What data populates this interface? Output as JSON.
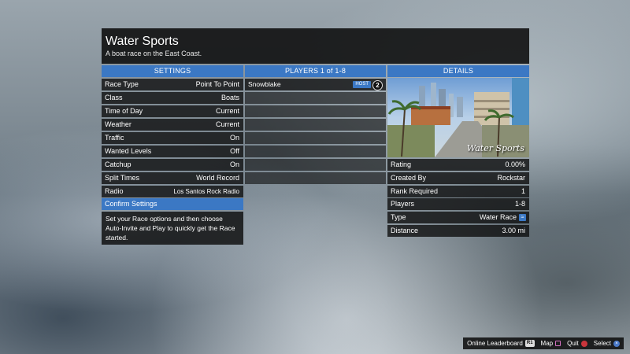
{
  "title": "Water Sports",
  "subtitle": "A boat race on the East Coast.",
  "columns": {
    "settings": "SETTINGS",
    "players": "PLAYERS 1 of 1-8",
    "details": "DETAILS"
  },
  "settings": [
    {
      "label": "Race Type",
      "value": "Point To Point"
    },
    {
      "label": "Class",
      "value": "Boats"
    },
    {
      "label": "Time of Day",
      "value": "Current"
    },
    {
      "label": "Weather",
      "value": "Current"
    },
    {
      "label": "Traffic",
      "value": "On"
    },
    {
      "label": "Wanted Levels",
      "value": "Off"
    },
    {
      "label": "Catchup",
      "value": "On"
    },
    {
      "label": "Split Times",
      "value": "World Record"
    },
    {
      "label": "Radio",
      "value": "Los Santos Rock Radio"
    }
  ],
  "confirm_label": "Confirm Settings",
  "info_text": "Set your Race options and then choose Auto-Invite and Play to quickly get the Race started.",
  "players": [
    {
      "name": "Snowblake",
      "badge": "HOST",
      "rank": "2"
    }
  ],
  "preview_caption": "Water Sports",
  "details": [
    {
      "label": "Rating",
      "value": "0.00%"
    },
    {
      "label": "Created By",
      "value": "Rockstar"
    },
    {
      "label": "Rank Required",
      "value": "1"
    },
    {
      "label": "Players",
      "value": "1-8"
    },
    {
      "label": "Type",
      "value": "Water Race"
    },
    {
      "label": "Distance",
      "value": "3.00 mi"
    }
  ],
  "bottom_bar": {
    "leaderboard": "Online Leaderboard",
    "leaderboard_key": "R1",
    "map": "Map",
    "quit": "Quit",
    "select": "Select"
  },
  "colors": {
    "accent": "#3b78c4",
    "panel": "#0c0c0c"
  }
}
